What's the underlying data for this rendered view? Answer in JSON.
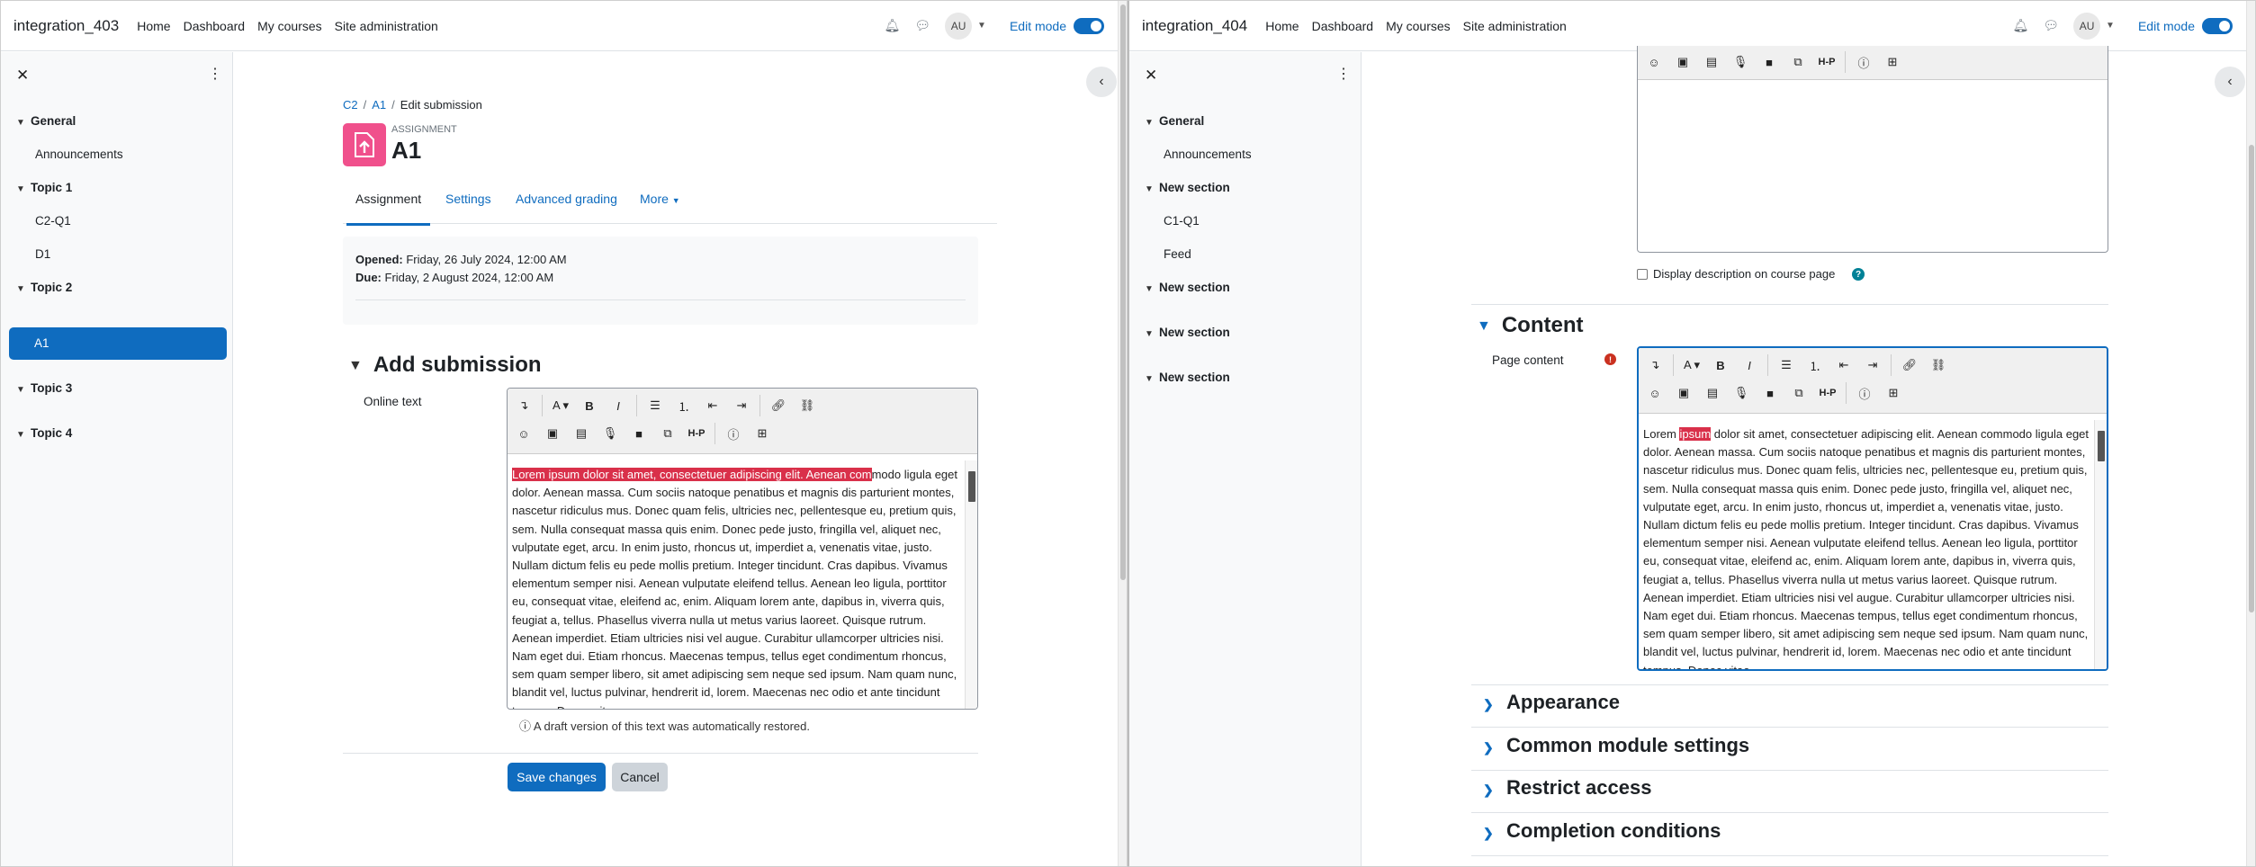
{
  "left": {
    "site_name": "integration_403",
    "nav": [
      "Home",
      "Dashboard",
      "My courses",
      "Site administration"
    ],
    "avatar": "AU",
    "edit_mode_label": "Edit mode",
    "drawer": {
      "sections": [
        {
          "label": "General",
          "items": [
            "Announcements"
          ]
        },
        {
          "label": "Topic 1",
          "items": [
            "C2-Q1",
            "D1"
          ]
        },
        {
          "label": "Topic 2",
          "items": [
            "A1"
          ]
        },
        {
          "label": "Topic 3",
          "items": []
        },
        {
          "label": "Topic 4",
          "items": []
        }
      ],
      "active_item": "A1"
    },
    "breadcrumb": [
      "C2",
      "A1",
      "Edit submission"
    ],
    "activity_type": "ASSIGNMENT",
    "activity_title": "A1",
    "tabs": [
      "Assignment",
      "Settings",
      "Advanced grading",
      "More"
    ],
    "opened_label": "Opened:",
    "opened_value": "Friday, 26 July 2024, 12:00 AM",
    "due_label": "Due:",
    "due_value": "Friday, 2 August 2024, 12:00 AM",
    "section_heading": "Add submission",
    "field_label": "Online text",
    "editor_selected": "Lorem ipsum dolor sit amet, consectetuer adipiscing elit. Aenean com",
    "editor_text": "modo ligula eget dolor. Aenean massa. Cum sociis natoque penatibus et magnis dis parturient montes, nascetur ridiculus mus. Donec quam felis, ultricies nec, pellentesque eu, pretium quis, sem. Nulla consequat massa quis enim. Donec pede justo, fringilla vel, aliquet nec, vulputate eget, arcu. In enim justo, rhoncus ut, imperdiet a, venenatis vitae, justo. Nullam dictum felis eu pede mollis pretium. Integer tincidunt. Cras dapibus. Vivamus elementum semper nisi. Aenean vulputate eleifend tellus. Aenean leo ligula, porttitor eu, consequat vitae, eleifend ac, enim. Aliquam lorem ante, dapibus in, viverra quis, feugiat a, tellus. Phasellus viverra nulla ut metus varius laoreet. Quisque rutrum. Aenean imperdiet. Etiam ultricies nisi vel augue. Curabitur ullamcorper ultricies nisi. Nam eget dui. Etiam rhoncus. Maecenas tempus, tellus eget condimentum rhoncus, sem quam semper libero, sit amet adipiscing sem neque sed ipsum. Nam quam nunc, blandit vel, luctus pulvinar, hendrerit id, lorem. Maecenas nec odio et ante tincidunt tempus. Donec vitae",
    "draft_note": "A draft version of this text was automatically restored.",
    "save_label": "Save changes",
    "cancel_label": "Cancel"
  },
  "right": {
    "site_name": "integration_404",
    "nav": [
      "Home",
      "Dashboard",
      "My courses",
      "Site administration"
    ],
    "avatar": "AU",
    "edit_mode_label": "Edit mode",
    "drawer": {
      "sections": [
        {
          "label": "General",
          "items": [
            "Announcements"
          ]
        },
        {
          "label": "New section",
          "items": [
            "C1-Q1",
            "Feed"
          ]
        },
        {
          "label": "New section",
          "items": []
        },
        {
          "label": "New section",
          "items": []
        },
        {
          "label": "New section",
          "items": []
        }
      ]
    },
    "display_desc_label": "Display description on course page",
    "content_heading": "Content",
    "page_content_label": "Page content",
    "editor_pre": "Lorem ",
    "editor_selected": "ipsum",
    "editor_text": " dolor sit amet, consectetuer adipiscing elit. Aenean commodo ligula eget dolor. Aenean massa. Cum sociis natoque penatibus et magnis dis parturient montes, nascetur ridiculus mus. Donec quam felis, ultricies nec, pellentesque eu, pretium quis, sem. Nulla consequat massa quis enim. Donec pede justo, fringilla vel, aliquet nec, vulputate eget, arcu. In enim justo, rhoncus ut, imperdiet a, venenatis vitae, justo. Nullam dictum felis eu pede mollis pretium. Integer tincidunt. Cras dapibus. Vivamus elementum semper nisi. Aenean vulputate eleifend tellus. Aenean leo ligula, porttitor eu, consequat vitae, eleifend ac, enim. Aliquam lorem ante, dapibus in, viverra quis, feugiat a, tellus. Phasellus viverra nulla ut metus varius laoreet. Quisque rutrum. Aenean imperdiet. Etiam ultricies nisi vel augue. Curabitur ullamcorper ultricies nisi. Nam eget dui. Etiam rhoncus. Maecenas tempus, tellus eget condimentum rhoncus, sem quam semper libero, sit amet adipiscing sem neque sed ipsum. Nam quam nunc, blandit vel, luctus pulvinar, hendrerit id, lorem. Maecenas nec odio et ante tincidunt tempus. Donec vitae",
    "collapsed_sections": [
      "Appearance",
      "Common module settings",
      "Restrict access",
      "Completion conditions"
    ]
  },
  "colors": {
    "primary": "#0f6cbf",
    "selection": "#d9304a",
    "assign_icon": "#f0508c"
  }
}
